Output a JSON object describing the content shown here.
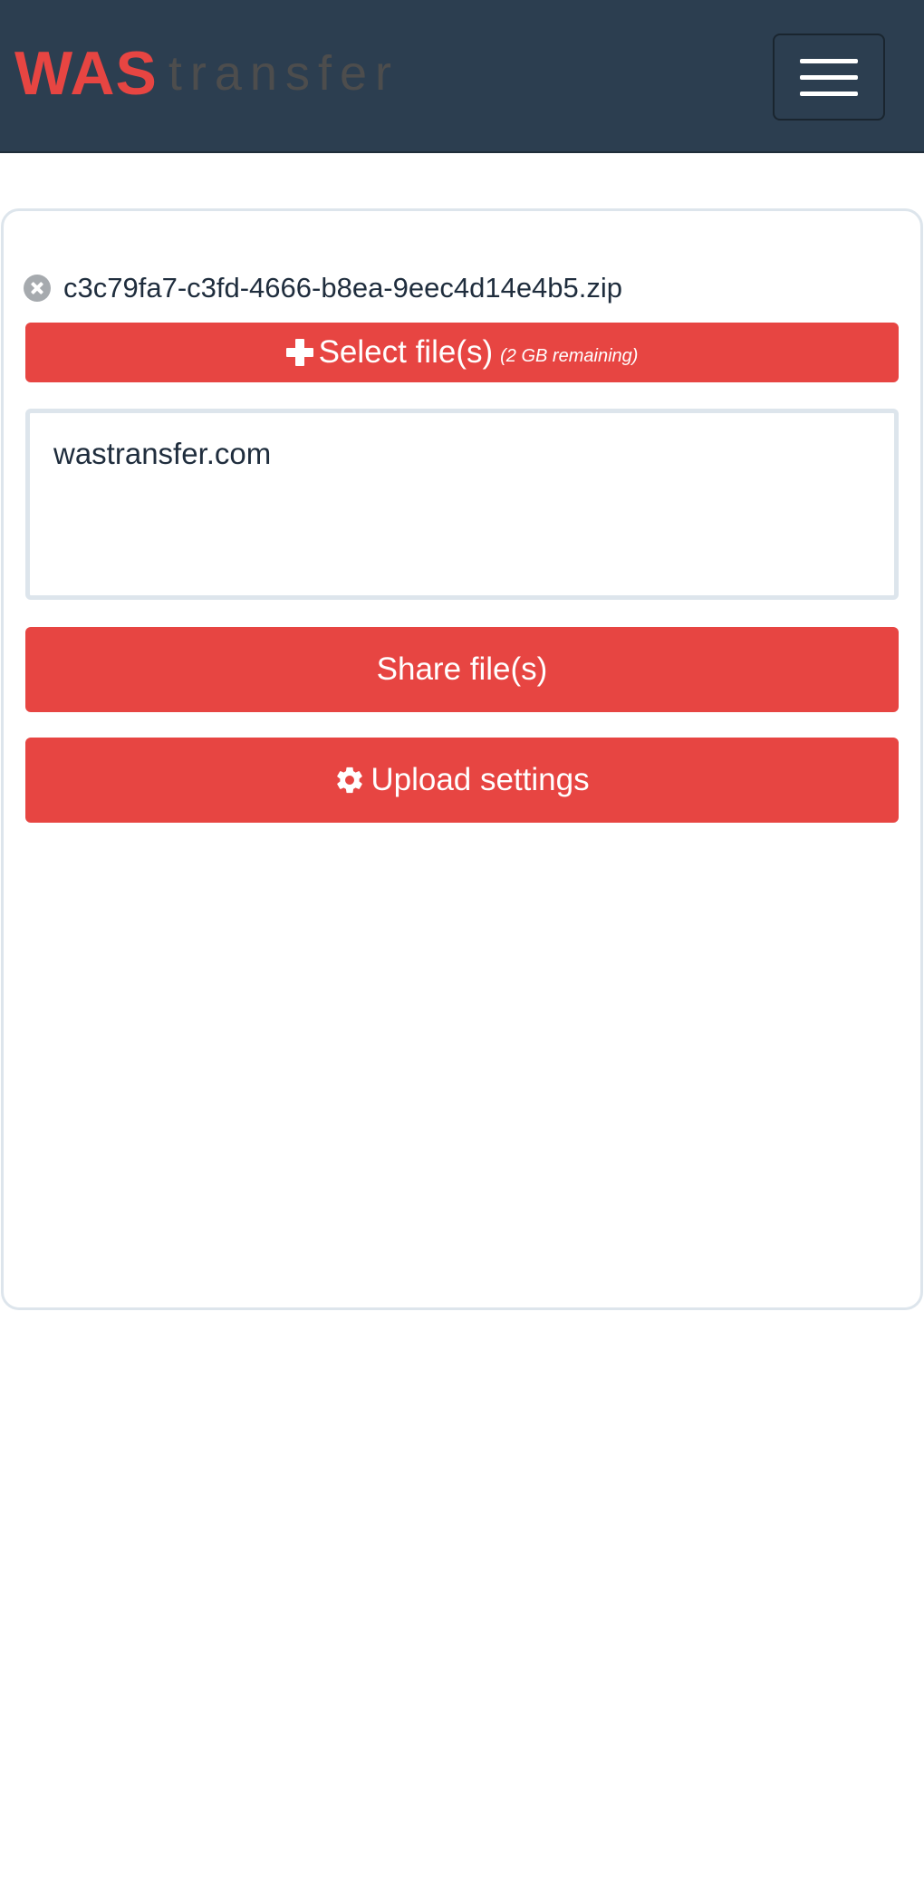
{
  "header": {
    "brand_primary": "WAS",
    "brand_secondary": "transfer",
    "menu_toggle_icon": "hamburger-icon"
  },
  "colors": {
    "navbar": "#2c3e50",
    "accent": "#e74542",
    "card_border": "#dde5ec"
  },
  "upload": {
    "file": {
      "name": "c3c79fa7-c3fd-4666-b8ea-9eec4d14e4b5.zip",
      "remove_icon": "close-circle-icon"
    },
    "select_button": {
      "icon": "plus-icon",
      "label": "Select file(s)",
      "remaining": "(2 GB remaining)"
    },
    "message": {
      "value": "wastransfer.com"
    },
    "share_button": {
      "label": "Share file(s)"
    },
    "settings_button": {
      "icon": "gear-icon",
      "label": "Upload settings"
    }
  }
}
